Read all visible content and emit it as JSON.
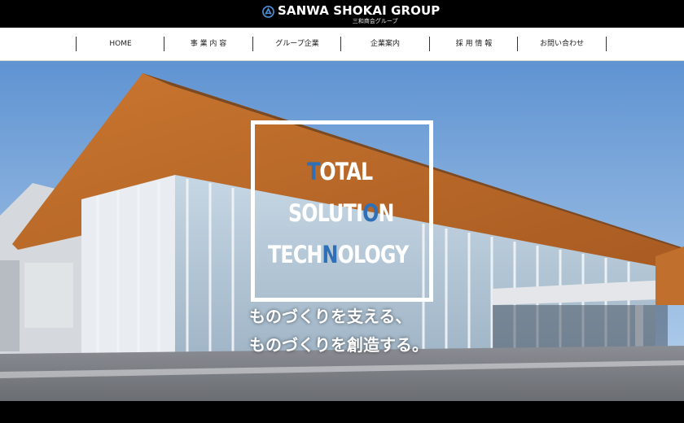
{
  "header": {
    "brand_name": "SANWA SHOKAI GROUP",
    "brand_sub": "三和商会グループ",
    "logo_icon": "sanwa-logo-icon"
  },
  "nav": {
    "items": [
      {
        "label": "HOME"
      },
      {
        "label": "事 業 内 容"
      },
      {
        "label": "グループ企業"
      },
      {
        "label": "企業案内"
      },
      {
        "label": "採 用 情 報"
      },
      {
        "label": "お問い合わせ"
      }
    ]
  },
  "hero": {
    "title_line1": "TOTAL",
    "title_line2_a": "SOLUTI",
    "title_line2_b": "O",
    "title_line2_c": "N",
    "title_line3_a": "TECH",
    "title_line3_b": "N",
    "title_line3_c": "OLOGY",
    "title_line1_a": "T",
    "title_line1_b": "OTAL",
    "copy_line1": "ものづくりを支える、",
    "copy_line2": "ものづくりを創造する。",
    "colors": {
      "accent": "#2f6fb6",
      "black": "#000000",
      "white": "#ffffff"
    }
  }
}
